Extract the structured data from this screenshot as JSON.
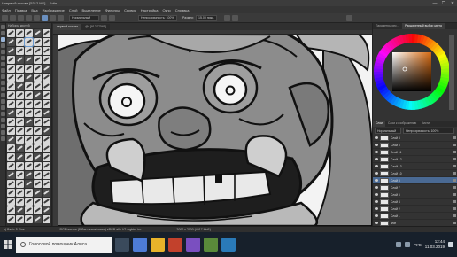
{
  "window": {
    "title": "* первый голова [5312 МБ] – Krita",
    "controls": [
      "—",
      "❐",
      "✕"
    ]
  },
  "menu": [
    "Файл",
    "Правка",
    "Вид",
    "Изображение",
    "Слой",
    "Выделение",
    "Фильтры",
    "Сервис",
    "Настройка",
    "Окно",
    "Справка"
  ],
  "toolbar": {
    "mode": "Нормальный",
    "opacity": "Непрозрачность: 100%",
    "size_label": "Размер:",
    "size": "15.00 пикс."
  },
  "brushes_header": "Наборы кистей",
  "document_tabs": [
    {
      "label": "первый голова",
      "active": true
    },
    {
      "label": "@* [912.77МБ]",
      "active": false
    }
  ],
  "status": {
    "brush": "b) Basic-5 Size",
    "colorspace": "RGB/альфа (8-бит целое/канал) sRGB-elle-V2-srgbtrc.icc",
    "dimensions": "2000 x 2000 (4917 МиБ)"
  },
  "right_panel": {
    "selector_tabs": [
      "Параметры инс…",
      "Расширенный выбор цвета"
    ],
    "layer_tabs": [
      "Слои",
      "Слои к изображению",
      "Кисти"
    ],
    "layer_mode": "Нормальный",
    "layer_opacity": "Непрозрачность: 100%",
    "layers": [
      {
        "name": "Слой 3",
        "selected": false
      },
      {
        "name": "Слой 5",
        "selected": false
      },
      {
        "name": "Слой 11",
        "selected": false
      },
      {
        "name": "Слой 12",
        "selected": false
      },
      {
        "name": "Слой 13",
        "selected": false
      },
      {
        "name": "Слой 10",
        "selected": false
      },
      {
        "name": "Слой 8",
        "selected": true
      },
      {
        "name": "Слой 7",
        "selected": false
      },
      {
        "name": "Слой 6",
        "selected": false
      },
      {
        "name": "Слой 4",
        "selected": false
      },
      {
        "name": "Слой 2",
        "selected": false
      },
      {
        "name": "Слой 1",
        "selected": false
      },
      {
        "name": "Фон",
        "selected": false
      }
    ]
  },
  "taskbar": {
    "search_placeholder": "Голосовой помощник Алиса",
    "time": "12:44",
    "date": "11.03.2019",
    "lang": "РУС"
  },
  "colors": {
    "accent": "#4a6a94",
    "taskbar": "#17202b"
  }
}
